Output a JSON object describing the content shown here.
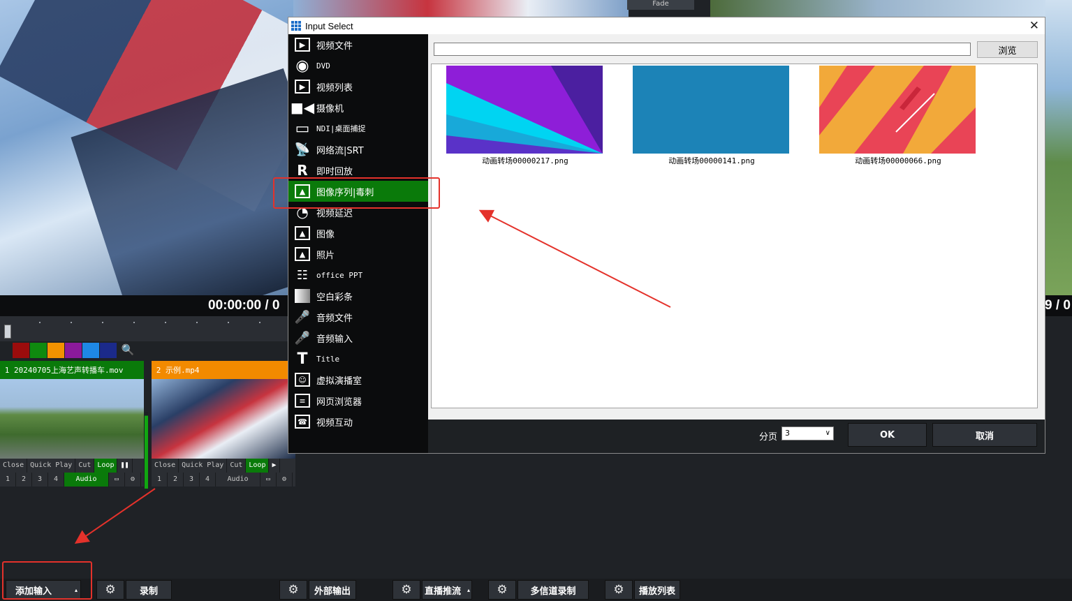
{
  "fade_label": "Fade",
  "timecode_left": "00:00:00  /  0",
  "timecode_right": "9  /  0",
  "color_swatches": [
    "#9b0c0c",
    "#0f8a0f",
    "#f29200",
    "#8b1a9b",
    "#1e88e5",
    "#1b2a8a"
  ],
  "tiles": [
    {
      "number": "1",
      "title": "20240705上海艺声转播车.mov",
      "head_color": "#0a7a0a",
      "controls": [
        "Close",
        "Quick Play",
        "Cut",
        "Loop"
      ],
      "play_icon": "pause-icon",
      "channels": [
        "1",
        "2",
        "3",
        "4"
      ],
      "audio_label": "Audio",
      "audio_on": true
    },
    {
      "number": "2",
      "title": "示例.mp4",
      "head_color": "#f28a00",
      "controls": [
        "Close",
        "Quick Play",
        "Cut",
        "Loop"
      ],
      "play_icon": "play-icon",
      "channels": [
        "1",
        "2",
        "3",
        "4"
      ],
      "audio_label": "Audio",
      "audio_on": false
    }
  ],
  "bottom_bar": {
    "add_input": "添加输入",
    "record": "录制",
    "external_output": "外部输出",
    "live_stream": "直播推流",
    "multi_record": "多信道录制",
    "playlist": "播放列表"
  },
  "dialog": {
    "title": "Input Select",
    "menu": [
      {
        "label": "视频文件",
        "icon": "video-file-icon"
      },
      {
        "label": "DVD",
        "icon": "dvd-icon"
      },
      {
        "label": "视频列表",
        "icon": "video-list-icon"
      },
      {
        "label": "摄像机",
        "icon": "camera-icon"
      },
      {
        "label": "NDI|桌面捕捉",
        "icon": "monitor-icon"
      },
      {
        "label": "网络流|SRT",
        "icon": "antenna-icon"
      },
      {
        "label": "即时回放",
        "icon": "replay-icon"
      },
      {
        "label": "图像序列|毒刺",
        "icon": "image-sequence-icon",
        "selected": true
      },
      {
        "label": "视频延迟",
        "icon": "timer-icon"
      },
      {
        "label": "图像",
        "icon": "image-icon"
      },
      {
        "label": "照片",
        "icon": "photos-icon"
      },
      {
        "label": "office PPT",
        "icon": "presentation-icon"
      },
      {
        "label": "空白彩条",
        "icon": "color-bars-icon"
      },
      {
        "label": "音频文件",
        "icon": "microphone-icon"
      },
      {
        "label": "音频输入",
        "icon": "microphone-icon"
      },
      {
        "label": "Title",
        "icon": "title-t-icon"
      },
      {
        "label": "虚拟演播室",
        "icon": "virtual-studio-icon"
      },
      {
        "label": "网页浏览器",
        "icon": "browser-icon"
      },
      {
        "label": "视频互动",
        "icon": "video-call-icon"
      }
    ],
    "path_value": "",
    "browse_label": "浏览",
    "files": [
      {
        "name": "动画转场00000217.png"
      },
      {
        "name": "动画转场00000141.png"
      },
      {
        "name": "动画转场00000066.png"
      }
    ],
    "page_label": "分页",
    "page_value": "3",
    "ok_label": "OK",
    "cancel_label": "取消"
  }
}
